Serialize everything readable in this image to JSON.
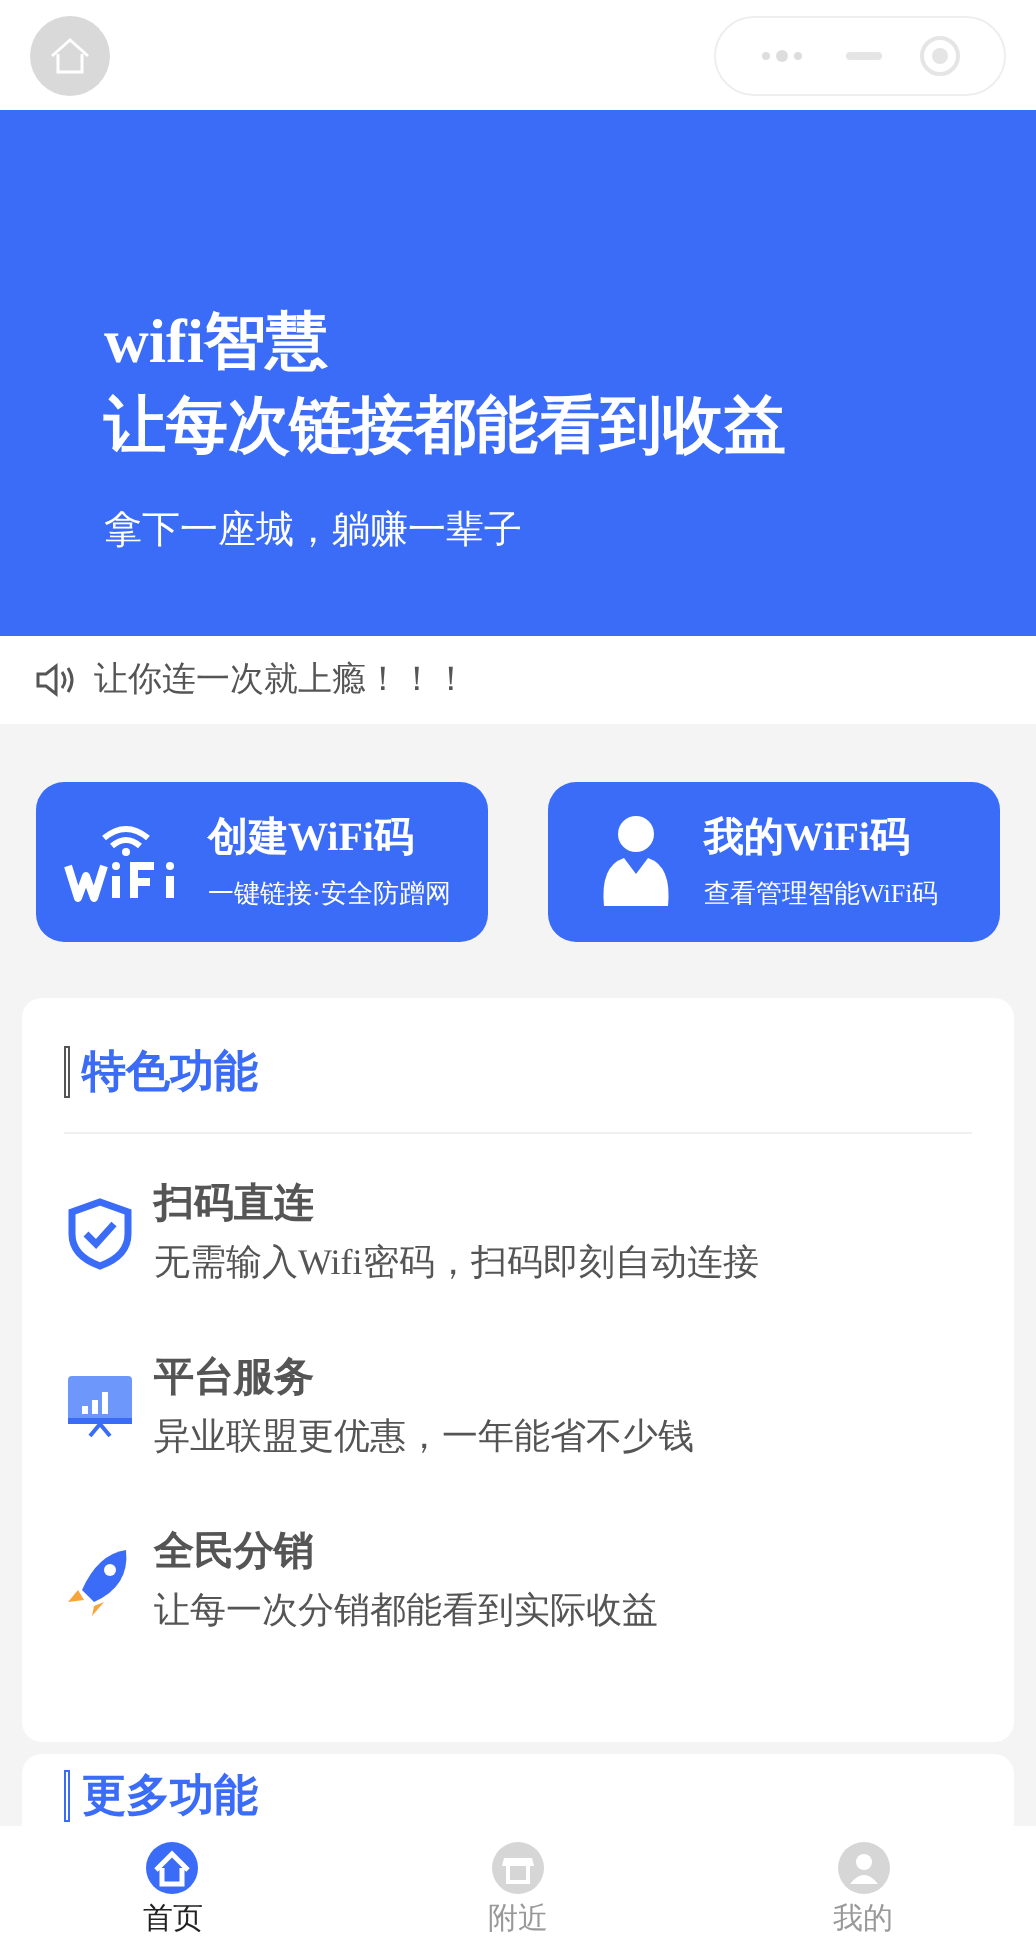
{
  "banner": {
    "title_lines": [
      "wifi智慧",
      "让每次链接都能看到收益"
    ],
    "subtitle": "拿下一座城，躺赚一辈子"
  },
  "notice": "让你连一次就上瘾！！！",
  "actions": [
    {
      "kind": "wifi",
      "title": "创建WiFi码",
      "subtitle": "一键链接·安全防蹭网"
    },
    {
      "kind": "user",
      "title": "我的WiFi码",
      "subtitle": "查看管理智能WiFi码"
    }
  ],
  "features": {
    "heading": "特色功能",
    "items": [
      {
        "kind": "shield",
        "title": "扫码直连",
        "description": "无需输入Wifi密码，扫码即刻自动连接"
      },
      {
        "kind": "board",
        "title": "平台服务",
        "description": "异业联盟更优惠，一年能省不少钱"
      },
      {
        "kind": "rocket",
        "title": "全民分销",
        "description": "让每一次分销都能看到实际收益"
      }
    ]
  },
  "more": {
    "heading": "更多功能"
  },
  "tab_bar": [
    {
      "kind": "home",
      "label": "首页",
      "selected": true
    },
    {
      "kind": "shop",
      "label": "附近",
      "selected": false
    },
    {
      "kind": "user",
      "label": "我的",
      "selected": false
    }
  ]
}
